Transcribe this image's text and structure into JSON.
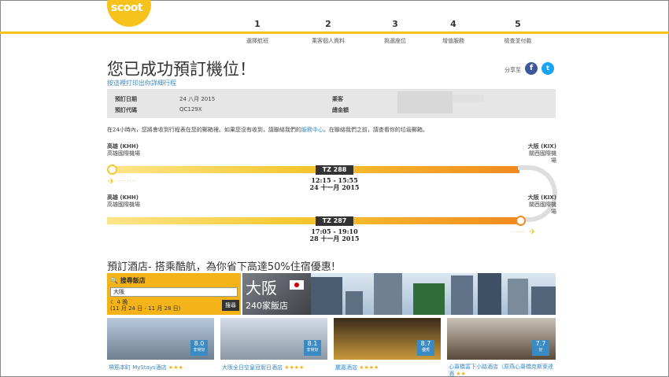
{
  "brand": {
    "logo_text": "scoot"
  },
  "steps": [
    {
      "num": "1",
      "label": "選擇航班"
    },
    {
      "num": "2",
      "label": "乘客個人資料"
    },
    {
      "num": "3",
      "label": "挑選座位"
    },
    {
      "num": "4",
      "label": "增值服務"
    },
    {
      "num": "5",
      "label": "檢查並付款"
    }
  ],
  "page": {
    "title": "您已成功預訂機位！",
    "print_link": "按這裡打印出你詳細行程",
    "share_label": "分享至"
  },
  "booking": {
    "date_label": "預訂日期",
    "date_value": "24 八月 2015",
    "code_label": "預訂代碼",
    "code_value": "QC129X",
    "passenger_label": "乘客",
    "total_label": "總金額"
  },
  "notice": {
    "before": "在24小時內，您將會收到行程表在您的郵箱裡。如果您沒有收到，請聯絡我們的",
    "link": "服務中心",
    "after": "。在聯絡我們之前，請查看你的垃圾郵箱。"
  },
  "flights": [
    {
      "from_code": "高雄 (KHH)",
      "from_name": "高雄國際機場",
      "to_code": "大阪 (KIX)",
      "to_name": "關西國際機場",
      "flight_no": "TZ 288",
      "times": "12:15 - 15:55",
      "date": "24 十一月 2015"
    },
    {
      "from_code": "高雄 (KHH)",
      "from_name": "高雄國際機場",
      "to_code": "大阪 (KIX)",
      "to_name": "關西國際機場",
      "flight_no": "TZ 287",
      "times": "17:05 - 19:10",
      "date": "28 十一月 2015"
    }
  ],
  "hotels": {
    "title": "預訂酒店- 搭乘酷航，為你省下高達50%住宿優惠!",
    "search_header": "搜尋飯店",
    "search_value": "大阪",
    "nights": "4 晚",
    "dates": "(11 月 24 日 - 11 月 28 日)",
    "search_button": "搜尋",
    "city_name": "大阪",
    "city_count": "240家飯店",
    "cards": [
      {
        "score": "8.0",
        "rating_label": "非常好",
        "name": "堺筋本町 MyStays酒店",
        "stars": "★★★"
      },
      {
        "score": "8.1",
        "rating_label": "非常好",
        "name": "大阪全日空皇冠假日酒店",
        "stars": "★★★★"
      },
      {
        "score": "8.7",
        "rating_label": "優秀",
        "name": "麗嘉酒店",
        "stars": "★★★★"
      },
      {
        "score": "7.7",
        "rating_label": "好",
        "name": "心齋橋富下小路酒店（原燕心齋橋克斯萊達酒",
        "stars": "★★"
      }
    ]
  },
  "colors": {
    "brand_yellow": "#f6c21c",
    "accent_orange": "#f28a1e",
    "link_blue": "#3a8ac4",
    "score_blue": "#3a8ac4"
  },
  "icons": [
    "facebook-icon",
    "twitter-icon",
    "plane-icon",
    "search-icon",
    "moon-icon"
  ]
}
